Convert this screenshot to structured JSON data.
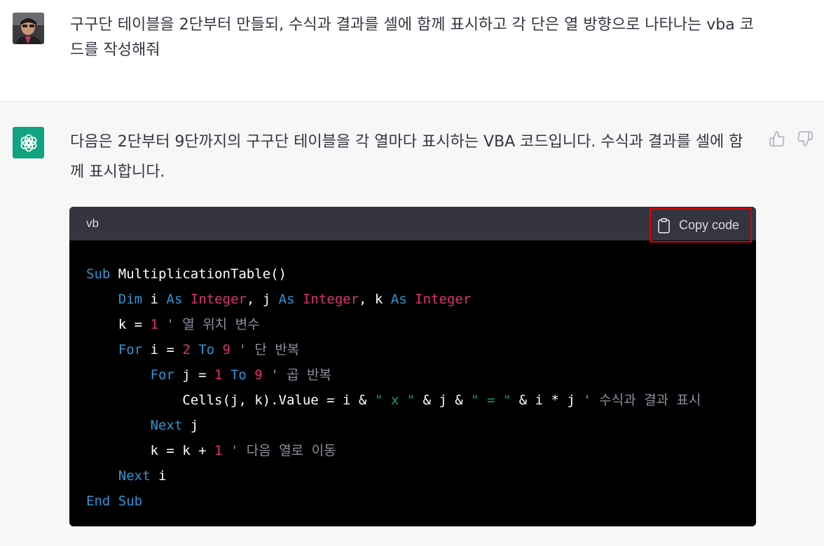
{
  "user": {
    "avatar": "user-photo",
    "message": "구구단 테이블을 2단부터 만들되, 수식과 결과를 셀에 함께 표시하고 각 단은 열 방향으로 나타나는 vba 코드를 작성해줘"
  },
  "assistant": {
    "avatar_icon": "openai-logo-icon",
    "avatar_color": "#10a37f",
    "message": "다음은 2단부터 9단까지의 구구단 테이블을 각 열마다 표시하는 VBA 코드입니다. 수식과 결과를 셀에 함께 표시합니다.",
    "feedback": {
      "thumbs_up_icon": "thumbs-up-icon",
      "thumbs_down_icon": "thumbs-down-icon"
    }
  },
  "code_block": {
    "language": "vb",
    "copy_label": "Copy code",
    "copy_icon": "clipboard-icon",
    "highlight_color": "#e10000",
    "lines": [
      [
        {
          "t": "kw",
          "v": "Sub"
        },
        {
          "t": "pl",
          "v": " MultiplicationTable()"
        }
      ],
      [
        {
          "t": "pl",
          "v": "    "
        },
        {
          "t": "kw",
          "v": "Dim"
        },
        {
          "t": "pl",
          "v": " i "
        },
        {
          "t": "kw",
          "v": "As"
        },
        {
          "t": "pl",
          "v": " "
        },
        {
          "t": "ty",
          "v": "Integer"
        },
        {
          "t": "pl",
          "v": ", j "
        },
        {
          "t": "kw",
          "v": "As"
        },
        {
          "t": "pl",
          "v": " "
        },
        {
          "t": "ty",
          "v": "Integer"
        },
        {
          "t": "pl",
          "v": ", k "
        },
        {
          "t": "kw",
          "v": "As"
        },
        {
          "t": "pl",
          "v": " "
        },
        {
          "t": "ty",
          "v": "Integer"
        }
      ],
      [
        {
          "t": "pl",
          "v": "    k = "
        },
        {
          "t": "num",
          "v": "1"
        },
        {
          "t": "cm",
          "v": " ' 열 위치 변수"
        }
      ],
      [
        {
          "t": "pl",
          "v": "    "
        },
        {
          "t": "kw",
          "v": "For"
        },
        {
          "t": "pl",
          "v": " i = "
        },
        {
          "t": "num",
          "v": "2"
        },
        {
          "t": "pl",
          "v": " "
        },
        {
          "t": "kw",
          "v": "To"
        },
        {
          "t": "pl",
          "v": " "
        },
        {
          "t": "num",
          "v": "9"
        },
        {
          "t": "cm",
          "v": " ' 단 반복"
        }
      ],
      [
        {
          "t": "pl",
          "v": "        "
        },
        {
          "t": "kw",
          "v": "For"
        },
        {
          "t": "pl",
          "v": " j = "
        },
        {
          "t": "num",
          "v": "1"
        },
        {
          "t": "pl",
          "v": " "
        },
        {
          "t": "kw",
          "v": "To"
        },
        {
          "t": "pl",
          "v": " "
        },
        {
          "t": "num",
          "v": "9"
        },
        {
          "t": "cm",
          "v": " ' 곱 반복"
        }
      ],
      [
        {
          "t": "pl",
          "v": "            Cells(j, k).Value = i & "
        },
        {
          "t": "str",
          "v": "\" x \""
        },
        {
          "t": "pl",
          "v": " & j & "
        },
        {
          "t": "str",
          "v": "\" = \""
        },
        {
          "t": "pl",
          "v": " & i * j"
        },
        {
          "t": "cm",
          "v": " ' 수식과 결과 표시"
        }
      ],
      [
        {
          "t": "pl",
          "v": "        "
        },
        {
          "t": "kw",
          "v": "Next"
        },
        {
          "t": "pl",
          "v": " j"
        }
      ],
      [
        {
          "t": "pl",
          "v": "        k = k + "
        },
        {
          "t": "num",
          "v": "1"
        },
        {
          "t": "cm",
          "v": " ' 다음 열로 이동"
        }
      ],
      [
        {
          "t": "pl",
          "v": "    "
        },
        {
          "t": "kw",
          "v": "Next"
        },
        {
          "t": "pl",
          "v": " i"
        }
      ],
      [
        {
          "t": "kw",
          "v": "End"
        },
        {
          "t": "pl",
          "v": " "
        },
        {
          "t": "kw",
          "v": "Sub"
        }
      ]
    ]
  }
}
